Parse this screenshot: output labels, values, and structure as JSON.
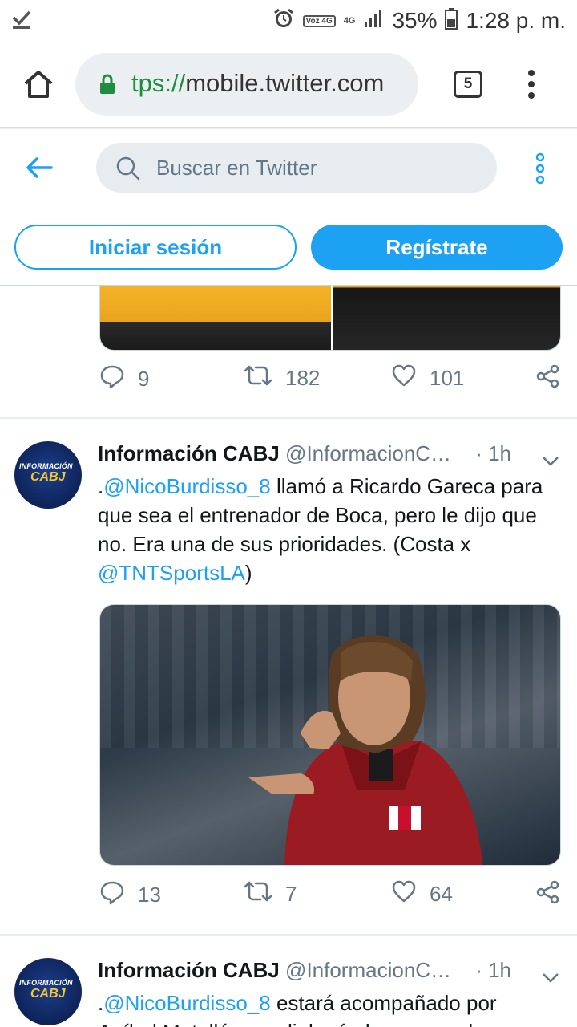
{
  "status_bar": {
    "network_badge": "Voz 4G",
    "network_type": "4G",
    "battery": "35%",
    "time": "1:28 p. m."
  },
  "browser": {
    "url_scheme": "tps://",
    "url_host": "mobile.twitter.com",
    "tab_count": "5"
  },
  "twitter_header": {
    "search_placeholder": "Buscar en Twitter",
    "login_label": "Iniciar sesión",
    "signup_label": "Regístrate"
  },
  "feed": {
    "previous_tweet": {
      "replies": "9",
      "retweets": "182",
      "likes": "101"
    },
    "tweets": [
      {
        "name": "Información CABJ",
        "handle": "@InformacionC…",
        "time": "· 1h",
        "text_parts": [
          ".",
          "@NicoBurdisso_8",
          " llamó a Ricardo Gareca para que sea el entrenador de Boca, pero le dijo que no. Era una de sus prioridades. (Costa x ",
          "@TNTSportsLA",
          ")"
        ],
        "replies": "13",
        "retweets": "7",
        "likes": "64"
      },
      {
        "name": "Información CABJ",
        "handle": "@InformacionC…",
        "time": "· 1h",
        "text_parts": [
          ".",
          "@NicoBurdisso_8",
          " estará acompañado por Aníbal Matellán, ya dialogó el ex marcador central"
        ]
      }
    ],
    "avatar_text_top": "INFORMACIÓN",
    "avatar_text_bottom": "CABJ"
  },
  "colors": {
    "twitter_blue": "#1da1f2",
    "secure_green": "#1e8e3e",
    "muted_text": "#657786"
  }
}
